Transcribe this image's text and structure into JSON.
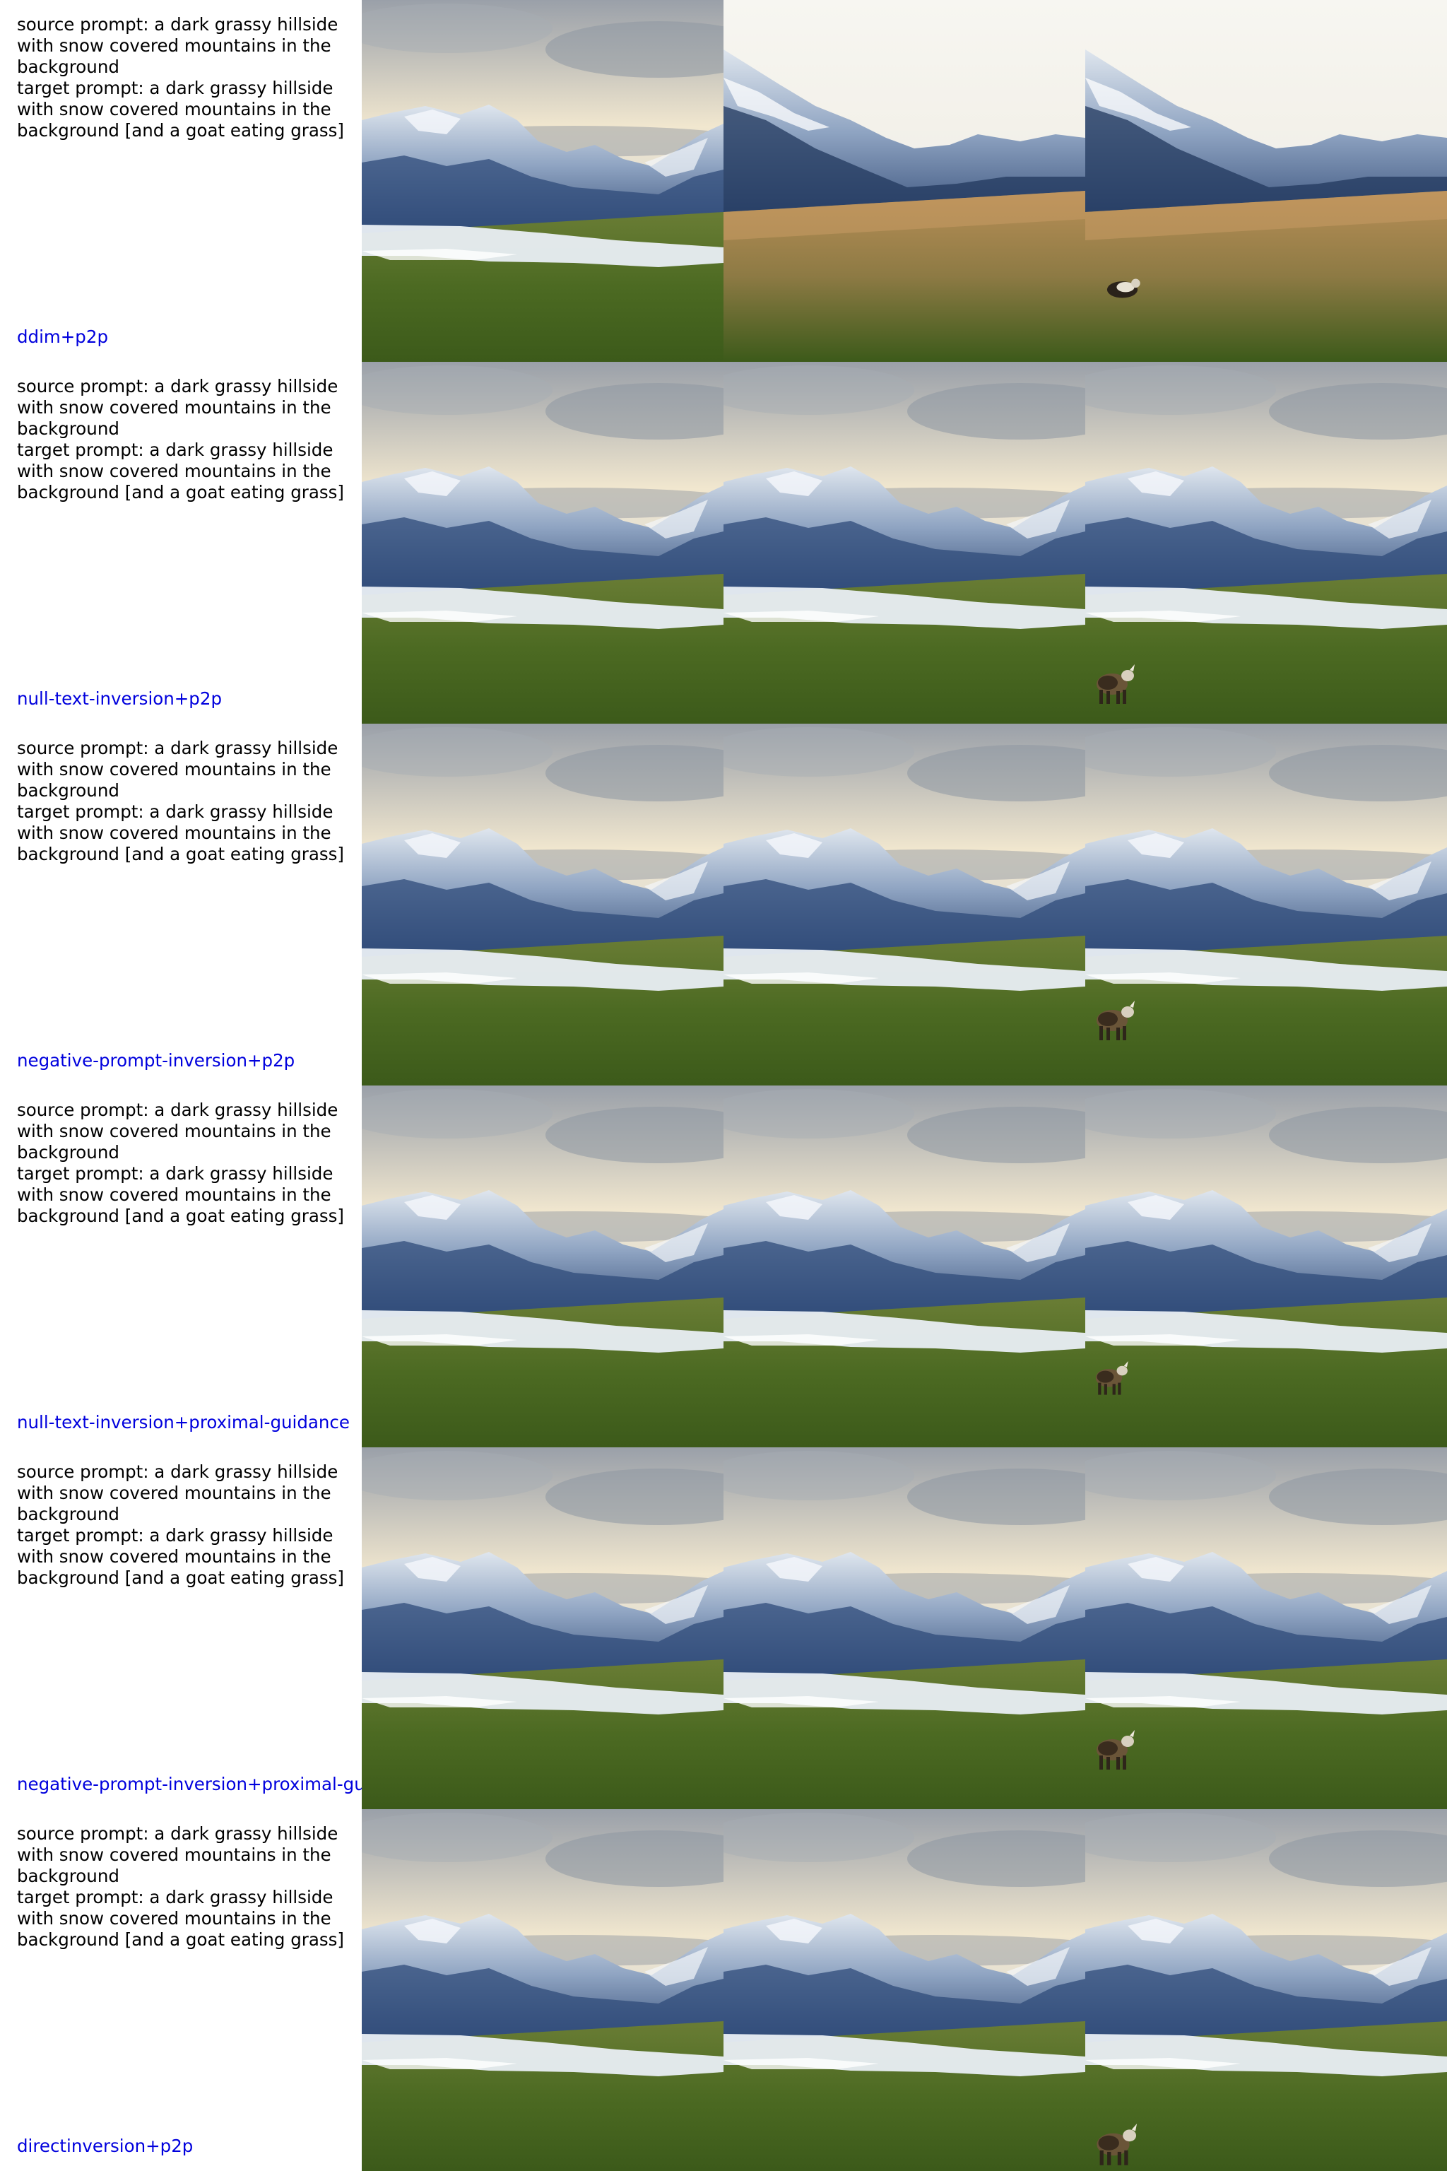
{
  "rows": [
    {
      "prompt": "source prompt: a dark grassy hillside\nwith snow covered mountains in the\nbackground\ntarget prompt: a dark grassy hillside\nwith snow covered mountains in the\nbackground [and a goat eating grass]",
      "method": "ddim+p2p"
    },
    {
      "prompt": "source prompt: a dark grassy hillside\nwith snow covered mountains in the\nbackground\ntarget prompt: a dark grassy hillside\nwith snow covered mountains in the\nbackground [and a goat eating grass]",
      "method": "null-text-inversion+p2p"
    },
    {
      "prompt": "source prompt: a dark grassy hillside\nwith snow covered mountains in the\nbackground\ntarget prompt: a dark grassy hillside\nwith snow covered mountains in the\nbackground [and a goat eating grass]",
      "method": "negative-prompt-inversion+p2p"
    },
    {
      "prompt": "source prompt: a dark grassy hillside\nwith snow covered mountains in the\nbackground\ntarget prompt: a dark grassy hillside\nwith snow covered mountains in the\nbackground [and a goat eating grass]",
      "method": "null-text-inversion+proximal-guidance"
    },
    {
      "prompt": "source prompt: a dark grassy hillside\nwith snow covered mountains in the\nbackground\ntarget prompt: a dark grassy hillside\nwith snow covered mountains in the\nbackground [and a goat eating grass]",
      "method": "negative-prompt-inversion+proximal-guidance"
    },
    {
      "prompt": "source prompt: a dark grassy hillside\nwith snow covered mountains in the\nbackground\ntarget prompt: a dark grassy hillside\nwith snow covered mountains in the\nbackground [and a goat eating grass]",
      "method": "directinversion+p2p"
    }
  ],
  "colors": {
    "label_text": "#000000",
    "method_label": "#0000dd",
    "sky_bright": "#f4efe0",
    "sky_cloud": "#b9bcc2",
    "mountain_dark": "#2e4a78",
    "mountain_snow": "#e6ecf3",
    "grass": "#4c6a22",
    "dry_grass": "#a88a4e",
    "goat": "#3a2c1e"
  }
}
